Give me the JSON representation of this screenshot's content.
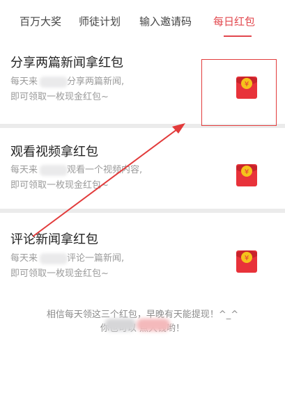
{
  "tabs": [
    {
      "label": "百万大奖"
    },
    {
      "label": "师徒计划"
    },
    {
      "label": "输入邀请码"
    },
    {
      "label": "每日红包",
      "active": true
    }
  ],
  "cards": [
    {
      "title": "分享两篇新闻拿红包",
      "desc_line1_a": "每天来",
      "desc_line1_b": "分享两篇新闻,",
      "desc_line2": "即可领取一枚现金红包~"
    },
    {
      "title": "观看视频拿红包",
      "desc_line1_a": "每天来",
      "desc_line1_b": "观看一个视频内容,",
      "desc_line2": "即可领取一枚现金红包~"
    },
    {
      "title": "评论新闻拿红包",
      "desc_line1_a": "每天来",
      "desc_line1_b": "评论一篇新闻,",
      "desc_line2": "即可领取一枚现金红包~"
    }
  ],
  "footer": {
    "line1": "相信每天领这三个红包，早晚有天能提现！^_^",
    "line2": "你也可以   点大钱哟！"
  },
  "colors": {
    "accent": "#e2474d",
    "redpack": "#e8323a",
    "coin": "#f5c21b",
    "annotation": "#e23b3b"
  }
}
